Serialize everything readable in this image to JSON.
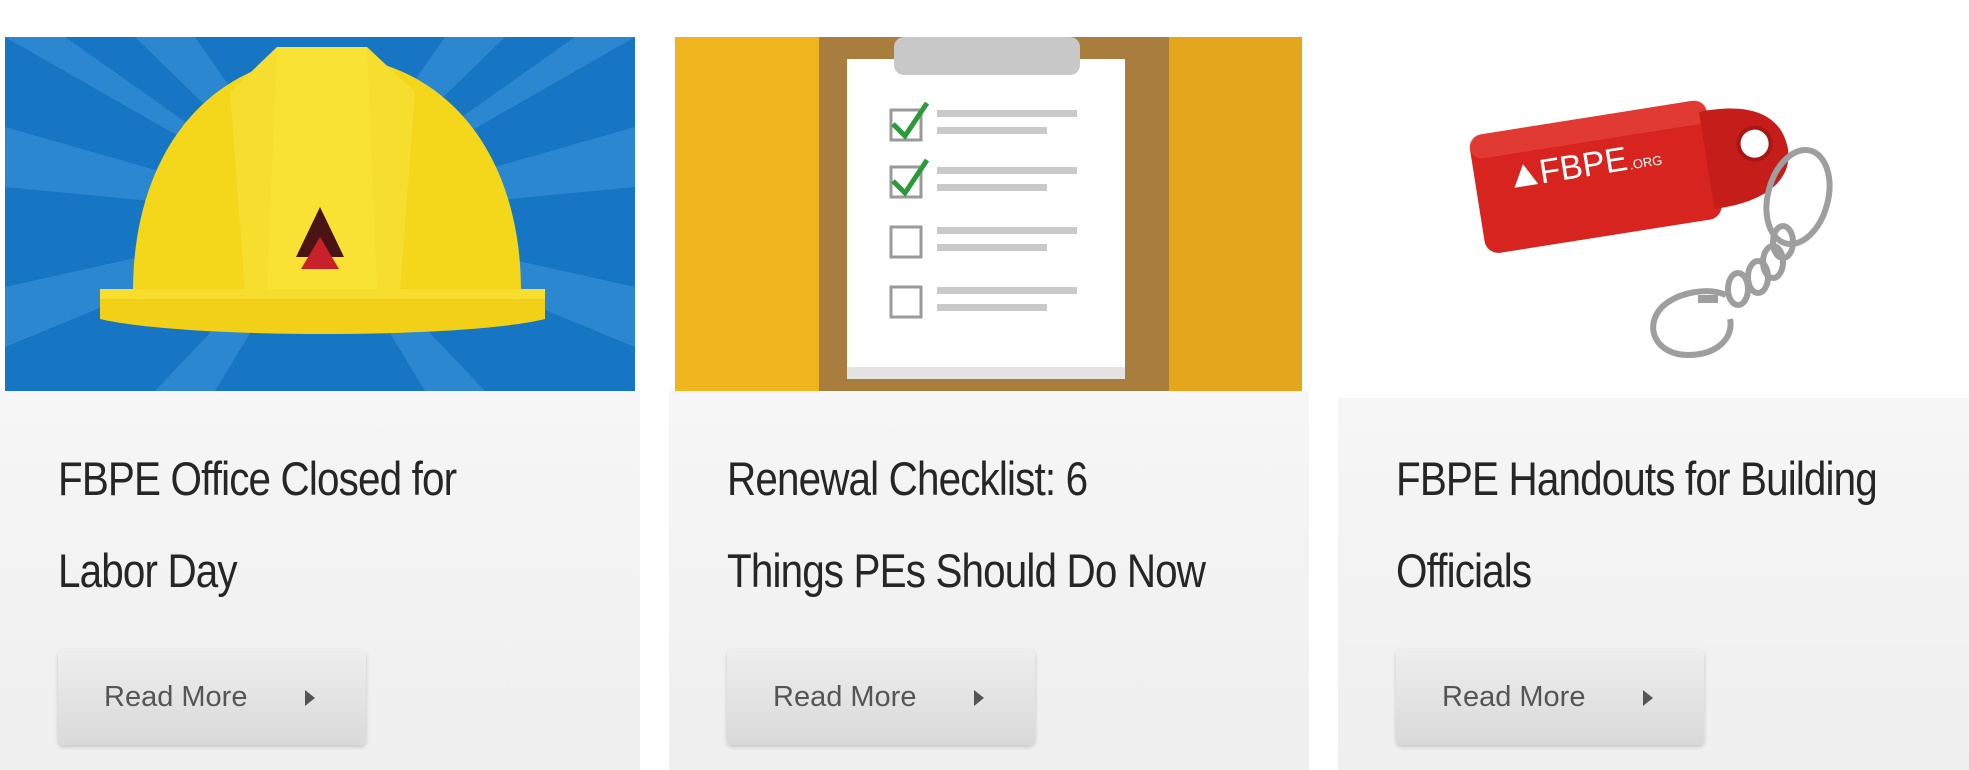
{
  "cards": [
    {
      "title": "FBPE Office Closed for Labor Day",
      "button_label": "Read More",
      "image": "hard-hat-illustration"
    },
    {
      "title": "Renewal Checklist: 6 Things PEs Should Do Now",
      "button_label": "Read More",
      "image": "clipboard-checklist-illustration"
    },
    {
      "title": "FBPE Handouts for Building Officials",
      "button_label": "Read More",
      "image": "usb-keychain-photo",
      "logo_text": "FBPE",
      "logo_suffix": ".ORG"
    }
  ],
  "colors": {
    "hat_background": "#1776c4",
    "hat_yellow": "#f4d61a",
    "clipboard_background": "#f0b41e",
    "usb_red": "#d8241f",
    "check_green": "#2b9a3b",
    "title_text": "#262626",
    "button_text": "#555555"
  }
}
